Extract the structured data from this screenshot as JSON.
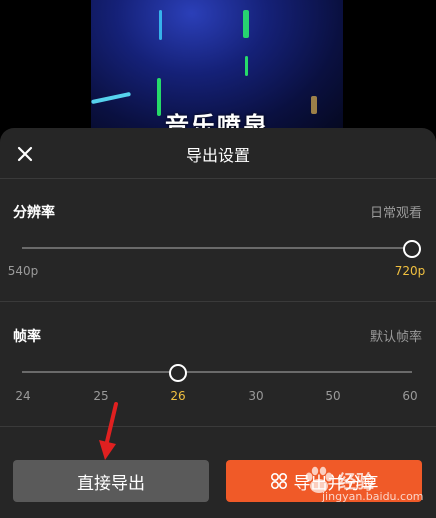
{
  "preview": {
    "caption": "音乐喷泉"
  },
  "header": {
    "title": "导出设置",
    "close_icon": "close-icon"
  },
  "resolution": {
    "label": "分辨率",
    "hint": "日常观看",
    "min_label": "540p",
    "max_label": "720p",
    "selected": "720p",
    "value_fraction": 1.0
  },
  "framerate": {
    "label": "帧率",
    "hint": "默认帧率",
    "ticks": [
      "24",
      "25",
      "26",
      "30",
      "50",
      "60"
    ],
    "selected": "26",
    "value_fraction": 0.4
  },
  "buttons": {
    "direct_export": "直接导出",
    "share_export": "导出并分享"
  },
  "watermark": {
    "line1": "经验",
    "line2": "jingyan.baidu.com"
  },
  "colors": {
    "accent": "#f05a28",
    "selected_tick": "#f0c040",
    "sheet_bg": "#262626",
    "secondary_button": "#5a5a5a",
    "annotation_arrow": "#e02020"
  }
}
